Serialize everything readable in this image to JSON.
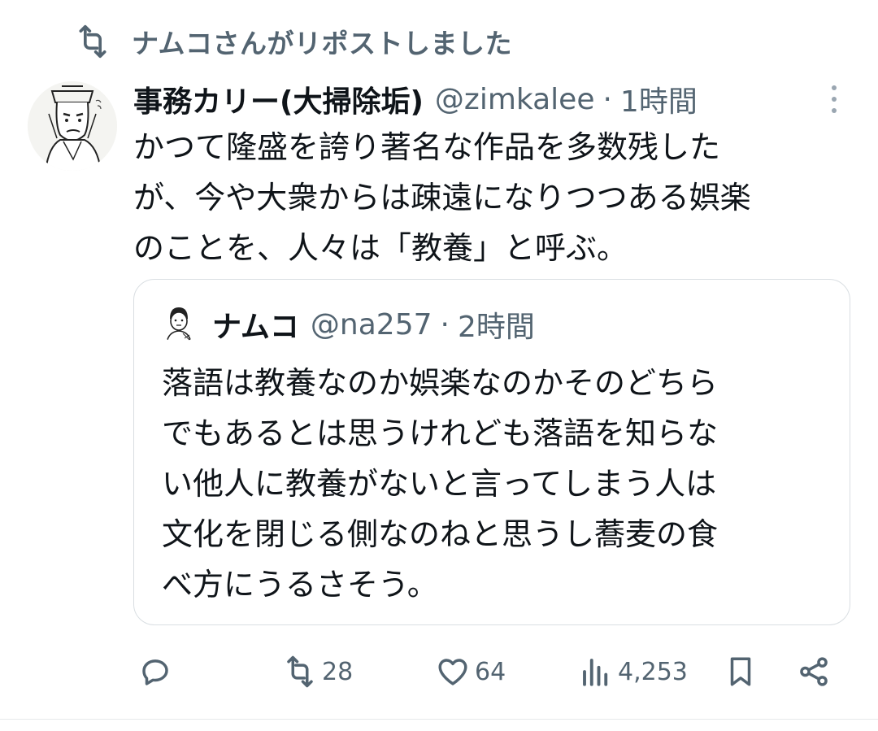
{
  "repost": {
    "text": "ナムコさんがリポストしました",
    "icon": "repost-icon"
  },
  "tweet": {
    "name": "事務カリー(大掃除垢)",
    "handle": "@zimkalee",
    "separator": "·",
    "time": "1時間",
    "lines": [
      "かつて隆盛を誇り著名な作品を多数残した",
      "が、今や大衆からは疎遠になりつつある娯楽",
      "のことを、人々は「教養」と呼ぶ。"
    ]
  },
  "quote": {
    "name": "ナムコ",
    "handle": "@na257",
    "separator": "·",
    "time": "2時間",
    "lines": [
      "落語は教養なのか娯楽なのかそのどちら",
      "でもあるとは思うけれども落語を知らな",
      "い他人に教養がないと言ってしまう人は",
      "文化を閉じる側なのねと思うし蕎麦の食",
      "べ方にうるさそう。"
    ]
  },
  "actions": {
    "reply": {
      "icon": "reply-icon"
    },
    "repost": {
      "icon": "repost-icon",
      "count": "28"
    },
    "like": {
      "icon": "heart-icon",
      "count": "64"
    },
    "views": {
      "icon": "views-icon",
      "count": "4,253"
    },
    "bookmark": {
      "icon": "bookmark-icon"
    },
    "share": {
      "icon": "share-icon"
    }
  },
  "colors": {
    "text": "#0f1419",
    "muted": "#536471",
    "border": "#d9dee2",
    "background": "#ffffff"
  }
}
